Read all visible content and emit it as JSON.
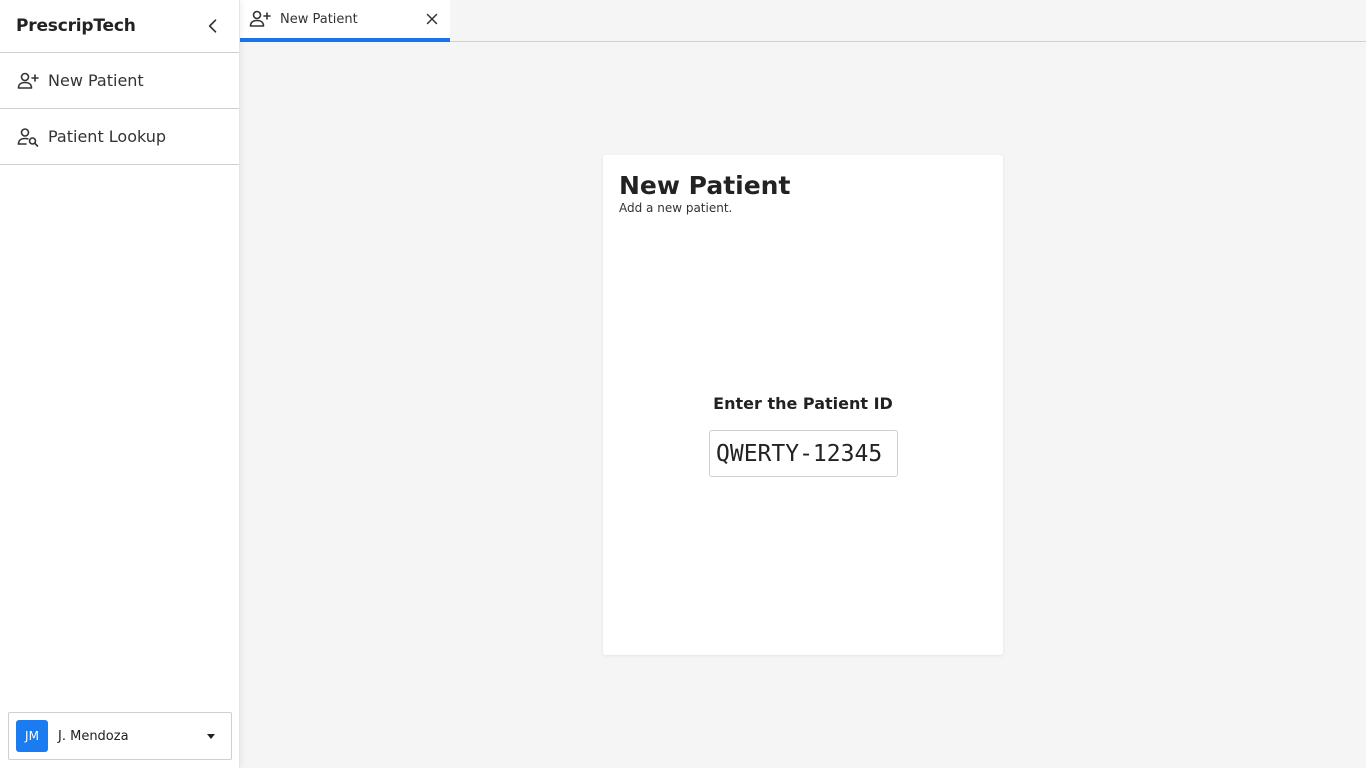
{
  "app": {
    "brand": "PrescripTech"
  },
  "sidebar": {
    "collapse_icon": "chevron-left-icon",
    "items": [
      {
        "label": "New Patient",
        "icon": "person-add-icon"
      },
      {
        "label": "Patient Lookup",
        "icon": "person-search-icon"
      }
    ]
  },
  "user": {
    "initials": "JM",
    "name": "J. Mendoza",
    "avatar_color": "#1a7cf0"
  },
  "tabs": [
    {
      "label": "New Patient",
      "icon": "person-add-icon",
      "active": true
    }
  ],
  "main": {
    "title": "New Patient",
    "subtitle": "Add a new patient.",
    "id_label": "Enter the Patient ID",
    "id_value": "QWERTY-12345"
  },
  "colors": {
    "accent": "#1a73e8",
    "background": "#f5f5f5"
  }
}
